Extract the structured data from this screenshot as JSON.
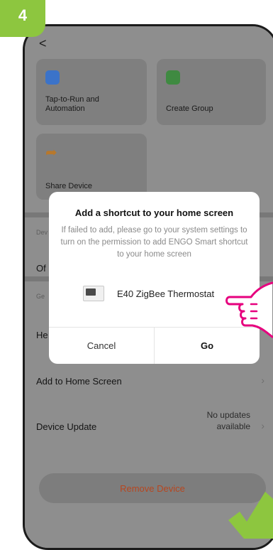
{
  "step_number": "4",
  "nav": {
    "back_symbol": "<"
  },
  "cards": {
    "tap_to_run": "Tap-to-Run and Automation",
    "create_group": "Create Group",
    "share_device": "Share Device"
  },
  "sections": {
    "device_partial": "Dev",
    "general_partial": "Ge"
  },
  "rows": {
    "offline_partial": "Of",
    "help_partial": "He",
    "add_home": "Add to Home Screen",
    "device_update": "Device Update",
    "update_status": "No updates available"
  },
  "modal": {
    "title": "Add a shortcut to your home screen",
    "body": "If failed to add, please go to your system settings to turn on the permission to add ENGO Smart shortcut to your home screen",
    "device_name": "E40 ZigBee Thermostat",
    "cancel": "Cancel",
    "go": "Go"
  },
  "remove_button": "Remove Device",
  "colors": {
    "badge": "#8dc63f",
    "remove_text": "#b7461f",
    "hand_outline": "#e6007e",
    "check": "#8dc63f"
  }
}
